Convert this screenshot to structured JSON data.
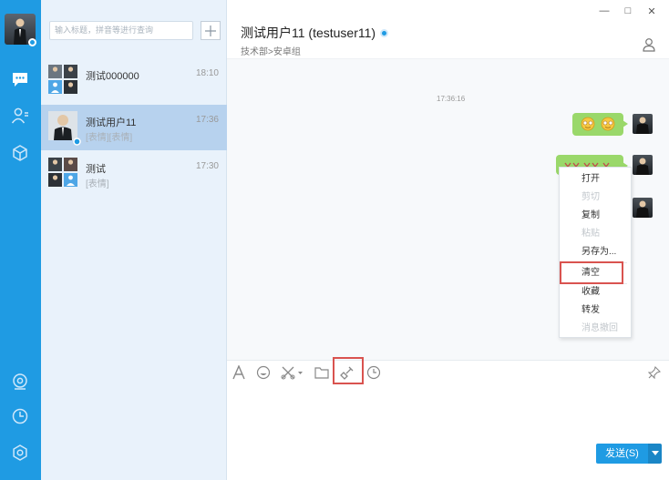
{
  "window": {
    "minimize_glyph": "—",
    "maximize_glyph": "□",
    "close_glyph": "✕"
  },
  "rail": {
    "nav_top": [
      "chat-icon",
      "contacts-icon",
      "cube-icon"
    ],
    "nav_bottom": [
      "location-icon",
      "clock-icon",
      "settings-icon"
    ],
    "accent": "#1f9be3"
  },
  "search": {
    "placeholder": "输入标题，拼音等进行查询"
  },
  "conversations": [
    {
      "name": "测试000000",
      "time": "18:10",
      "preview": ""
    },
    {
      "name": "测试用户11",
      "time": "17:36",
      "preview": "[表情][表情]"
    },
    {
      "name": "测试",
      "time": "17:30",
      "preview": "[表情]"
    }
  ],
  "chat": {
    "title": "测试用户11 (testuser11)",
    "subtitle": "技术部>安卓组",
    "timestamp": "17:36:16"
  },
  "context_menu": {
    "items": [
      {
        "label": "打开",
        "enabled": true
      },
      {
        "label": "剪切",
        "enabled": false
      },
      {
        "label": "复制",
        "enabled": true
      },
      {
        "label": "粘贴",
        "enabled": false
      },
      {
        "label": "另存为...",
        "enabled": true
      },
      {
        "label": "清空",
        "enabled": true
      },
      {
        "label": "收藏",
        "enabled": true
      },
      {
        "label": "转发",
        "enabled": true
      },
      {
        "label": "消息撤回",
        "enabled": false
      }
    ]
  },
  "toolbar": {
    "tools": [
      "font-icon",
      "emoji-icon",
      "screenshot-icon",
      "folder-icon",
      "clear-icon",
      "history-icon"
    ],
    "pin_icon": "pin-icon"
  },
  "send": {
    "label": "发送(S)"
  },
  "highlight_color": "#d9534f"
}
